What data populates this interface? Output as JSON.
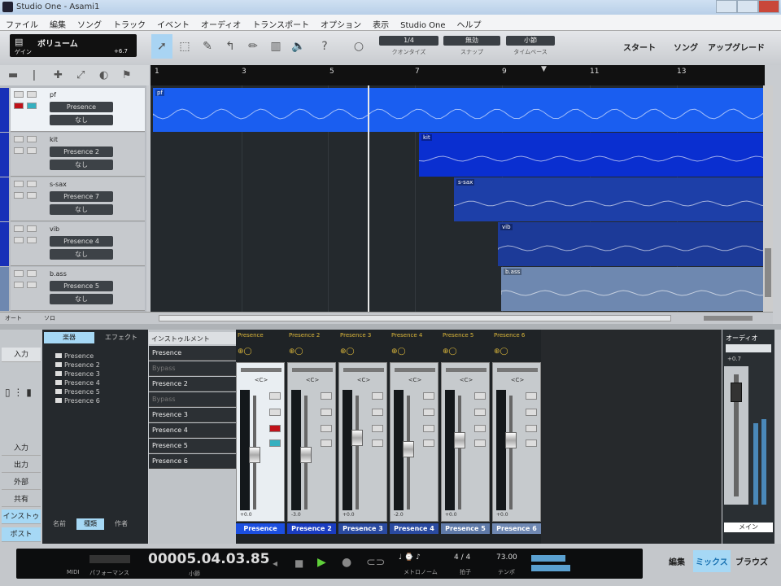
{
  "window": {
    "title": "Studio One - Asami1"
  },
  "menu": [
    "ファイル",
    "編集",
    "ソング",
    "トラック",
    "イベント",
    "オーディオ",
    "トランスポート",
    "オプション",
    "表示",
    "Studio One",
    "ヘルプ"
  ],
  "toolbar": {
    "display_title": "ボリューム",
    "display_sub": "ゲイン",
    "display_value": "+6.7",
    "quantize": {
      "value": "1/4",
      "label": "クオンタイズ"
    },
    "snap": {
      "value": "無効",
      "label": "スナップ"
    },
    "timebase": {
      "value": "小節",
      "label": "タイムベース"
    },
    "start": "スタート",
    "song": "ソング",
    "upgrade": "アップグレード"
  },
  "ruler": [
    "1",
    "3",
    "5",
    "7",
    "9",
    "11",
    "13"
  ],
  "tracks": [
    {
      "name": "pf",
      "instrument": "Presence",
      "output": "なし",
      "color": "#1a5ef0",
      "clip": "pf"
    },
    {
      "name": "kit",
      "instrument": "Presence 2",
      "output": "なし",
      "color": "#0a2fd0",
      "clip": "kit"
    },
    {
      "name": "s-sax",
      "instrument": "Presence 7",
      "output": "なし",
      "color": "#1d3fa8",
      "clip": "s-sax"
    },
    {
      "name": "vib",
      "instrument": "Presence 4",
      "output": "なし",
      "color": "#1c3a98",
      "clip": "vib"
    },
    {
      "name": "b.ass",
      "instrument": "Presence 5",
      "output": "なし",
      "color": "#6e88b0",
      "clip": "b.ass"
    }
  ],
  "footer_left": {
    "auto": "オート",
    "solo": "ソロ"
  },
  "nav": {
    "top": "入力",
    "items": [
      "入力",
      "出力",
      "外部",
      "共有",
      "インストゥルメント",
      "ポスト"
    ]
  },
  "browser": {
    "tabs": [
      "楽器",
      "エフェクト"
    ],
    "items": [
      "Presence",
      "Presence 2",
      "Presence 3",
      "Presence 4",
      "Presence 5",
      "Presence 6"
    ],
    "bottom_tabs": [
      "名前",
      "種類",
      "作者"
    ]
  },
  "channel_list": {
    "header": "インストゥルメント",
    "rows": [
      {
        "name": "Presence",
        "sub": false
      },
      {
        "name": "Bypass",
        "sub": true
      },
      {
        "name": "Presence 2",
        "sub": false
      },
      {
        "name": "Bypass",
        "sub": true
      },
      {
        "name": "Presence 3",
        "sub": false
      },
      {
        "name": "Presence 4",
        "sub": false
      },
      {
        "name": "Presence 5",
        "sub": false
      },
      {
        "name": "Presence 6",
        "sub": false
      }
    ]
  },
  "mixer": {
    "channels": [
      {
        "name": "Presence",
        "pan": "<C>",
        "vol": "+0.0",
        "level": 0.55,
        "color": "#1c4fe0"
      },
      {
        "name": "Presence 2",
        "pan": "<C>",
        "vol": "-3.0",
        "level": 0.55,
        "color": "#1a3cc0"
      },
      {
        "name": "Presence 3",
        "pan": "<C>",
        "vol": "+0.0",
        "level": 0.7,
        "color": "#2a4aa0"
      },
      {
        "name": "Presence 4",
        "pan": "<C>",
        "vol": "-2.0",
        "level": 0.6,
        "color": "#2a4aa0"
      },
      {
        "name": "Presence 5",
        "pan": "<C>",
        "vol": "+0.0",
        "level": 0.68,
        "color": "#5f7aa8"
      },
      {
        "name": "Presence 6",
        "pan": "<C>",
        "vol": "+0.0",
        "level": 0.68,
        "color": "#6f88b2"
      }
    ],
    "main": {
      "name": "メイン",
      "vol": "+0.7",
      "output": "オーディオ"
    }
  },
  "transport": {
    "midi": "MIDI",
    "performance": "パフォーマンス",
    "position": "00005.04.03.85",
    "position_unit": "小節",
    "metronome": "メトロノーム",
    "signature": "4 / 4",
    "signature_label": "拍子",
    "tempo": "73.00",
    "tempo_label": "テンポ"
  },
  "views": [
    "編集",
    "ミックス",
    "ブラウズ"
  ]
}
